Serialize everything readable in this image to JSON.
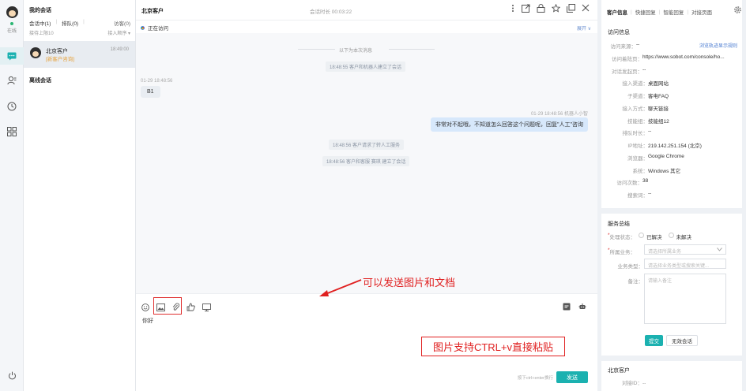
{
  "rail": {
    "status_label": "在线",
    "items": [
      "chat-icon",
      "contacts-icon",
      "history-icon",
      "apps-icon",
      "power-icon"
    ]
  },
  "sessions": {
    "title": "我的会话",
    "tab_active": "会话中(1)",
    "tab_queue": "排队(0)",
    "tab_visit": "访客(0)",
    "sort_left": "接待上限10",
    "sort_right": "接入顺序 ▾",
    "item": {
      "name": "北京客户",
      "time": "18:49:00",
      "tag": "[新客户咨询]"
    },
    "offline_title": "离线会话"
  },
  "chat": {
    "customer_name": "北京客户",
    "duration": "会话时长 00:03:22",
    "visiting": "正在访问",
    "expand": "展开 ∨",
    "divider": "以下为本次消息",
    "sys1": "18:48:55 客户和机器人建立了会话",
    "customer_time": "01-29 18:48:56",
    "customer_msg": "B1",
    "agent_meta": "01-29 18:48:56  机器人小智",
    "agent_msg": "非常对不起哦，不知道怎么回答这个问题呢，回复\"人工\"咨询",
    "sys2": "18:48:56 客户请求了转人工服务",
    "sys3": "18:48:56 客户和客服 赛琪 建立了会话",
    "input_text": "你好",
    "send_hint": "按下ctrl+enter换行",
    "send_label": "发送"
  },
  "annotations": {
    "upload_note": "可以发送图片和文档",
    "paste_note": "图片支持CTRL+v直接粘贴"
  },
  "right": {
    "tabs": [
      "客户信息",
      "快捷回复",
      "智能回复",
      "对接页面"
    ],
    "visit_title": "访问信息",
    "visit_fields": [
      {
        "k": "访问来源：",
        "v": "--"
      },
      {
        "k": "访问着陆页：",
        "v": "https://www.sobot.com/console/ho..."
      },
      {
        "k": "对话发起页：",
        "v": "--"
      },
      {
        "k": "接入渠道：",
        "v": "桌面网站"
      },
      {
        "k": "子渠道：",
        "v": "客电FAQ"
      },
      {
        "k": "接入方式：",
        "v": "聊天链接"
      },
      {
        "k": "技能组：",
        "v": "技能组12"
      },
      {
        "k": "排队时长：",
        "v": "--"
      },
      {
        "k": "IP地址：",
        "v": "219.142.251.154 (北京)"
      },
      {
        "k": "浏览器：",
        "v": "Google Chrome"
      },
      {
        "k": "系统：",
        "v": "Windows 其它"
      },
      {
        "k": "访问次数：",
        "v": "38"
      },
      {
        "k": "搜索词：",
        "v": "--"
      }
    ],
    "track_link": "浏览轨迹显示规则",
    "service_title": "服务总结",
    "status_label": "处理状态：",
    "status_opt1": "已解决",
    "status_opt2": "未解决",
    "biz_label": "所属业务：",
    "biz_placeholder": "请选择所属业务",
    "type_label": "业务类型：",
    "type_placeholder": "请选择业务类型或搜索关键...",
    "note_label": "备注：",
    "note_placeholder": "请输入备注",
    "submit_label": "提交",
    "invalid_label": "无效会话",
    "bottom_name": "北京客户",
    "bottom_field": "对接ID：--"
  }
}
